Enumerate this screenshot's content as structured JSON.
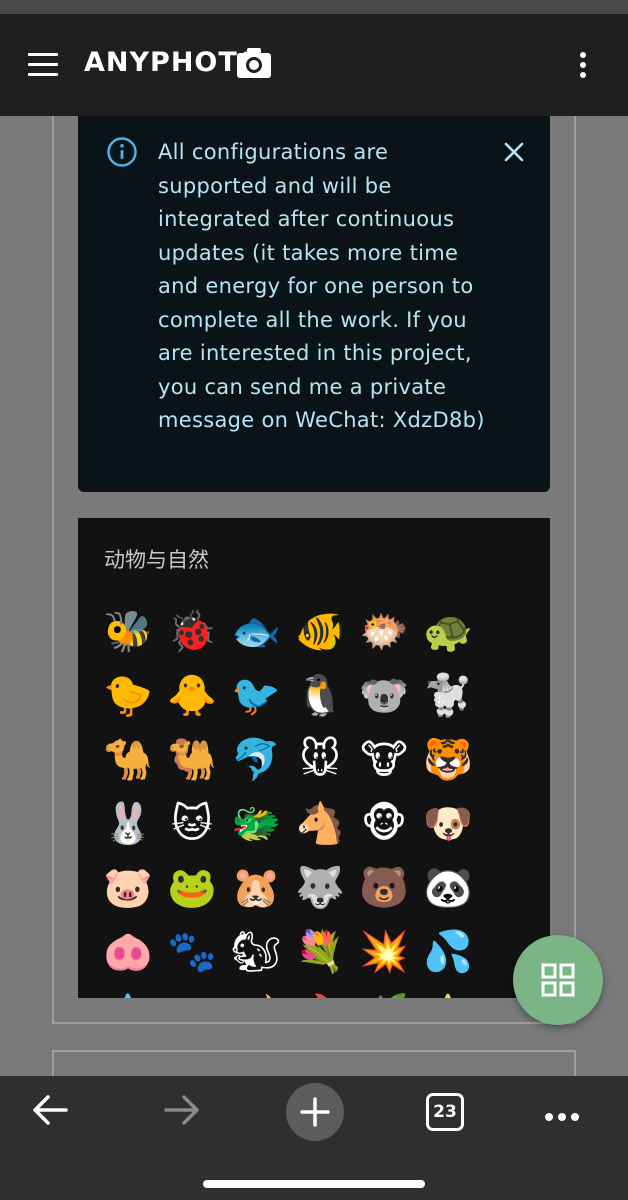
{
  "app_bar": {
    "title": "ANYPHOTO",
    "menu_icon": "hamburger-menu-icon",
    "camera_icon": "camera-icon",
    "overflow_icon": "kebab-menu-icon"
  },
  "alert": {
    "icon": "info-icon",
    "message": "All configurations are supported and will be integrated after continuous updates (it takes more time and energy for one person to complete all the work. If you are interested in this project, you can send me a private message on WeChat: XdzD8b)",
    "close_icon": "close-icon",
    "accent_color": "#4fb3e8"
  },
  "emoji_panel": {
    "title": "动物与自然",
    "emojis": [
      "🐝",
      "🐞",
      "🐟",
      "🐠",
      "🐡",
      "🐢",
      "🐤",
      "🐥",
      "🐦",
      "🐧",
      "🐨",
      "🐩",
      "🐪",
      "🐫",
      "🐬",
      "🐭",
      "🐮",
      "🐯",
      "🐰",
      "🐱",
      "🐲",
      "🐴",
      "🐵",
      "🐶",
      "🐷",
      "🐸",
      "🐹",
      "🐺",
      "🐻",
      "🐼",
      "🐽",
      "🐾",
      "🐿",
      "💐",
      "💥",
      "💦",
      "💧",
      "☁",
      "🌙",
      "🔥",
      "🌿",
      "⭐"
    ]
  },
  "fab": {
    "icon": "grid-icon",
    "color": "#7bb585"
  },
  "bottom_nav": {
    "back_icon": "back-arrow-icon",
    "forward_icon": "forward-arrow-icon",
    "new_tab_icon": "plus-icon",
    "tab_count": "23",
    "more_icon": "more-dots-icon"
  }
}
